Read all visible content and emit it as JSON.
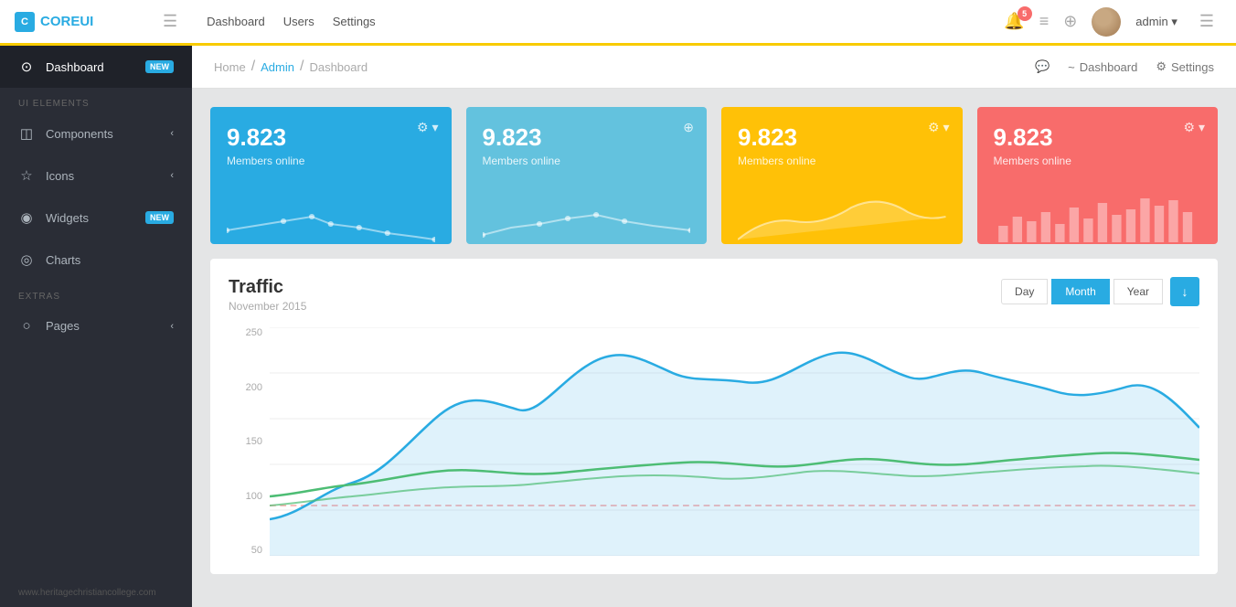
{
  "topNav": {
    "logo": "COREUI",
    "links": [
      "Dashboard",
      "Users",
      "Settings"
    ],
    "badge": "5",
    "adminLabel": "admin"
  },
  "sidebar": {
    "activeItem": "Dashboard",
    "items": [
      {
        "id": "dashboard",
        "label": "Dashboard",
        "icon": "⊙",
        "badge": "NEW",
        "active": true
      },
      {
        "id": "section-ui",
        "label": "UI ELEMENTS",
        "section": true
      },
      {
        "id": "components",
        "label": "Components",
        "icon": "◫",
        "chevron": "‹"
      },
      {
        "id": "icons",
        "label": "Icons",
        "icon": "☆",
        "chevron": "‹"
      },
      {
        "id": "widgets",
        "label": "Widgets",
        "icon": "◉",
        "badge": "NEW"
      },
      {
        "id": "charts",
        "label": "Charts",
        "icon": "◎"
      },
      {
        "id": "section-extras",
        "label": "EXTRAS",
        "section": true
      },
      {
        "id": "pages",
        "label": "Pages",
        "icon": "○",
        "chevron": "‹"
      }
    ],
    "footer": "www.heritagechristiancollege.com"
  },
  "breadcrumb": {
    "items": [
      "Home",
      "Admin",
      "Dashboard"
    ],
    "rightActions": [
      "Dashboard",
      "Settings"
    ]
  },
  "statCards": [
    {
      "id": "card1",
      "number": "9.823",
      "label": "Members online",
      "color": "blue1",
      "gearVisible": true
    },
    {
      "id": "card2",
      "number": "9.823",
      "label": "Members online",
      "color": "blue2",
      "gearVisible": false
    },
    {
      "id": "card3",
      "number": "9.823",
      "label": "Members online",
      "color": "yellow",
      "gearVisible": true
    },
    {
      "id": "card4",
      "number": "9.823",
      "label": "Members online",
      "color": "red",
      "gearVisible": true
    }
  ],
  "traffic": {
    "title": "Traffic",
    "subtitle": "November 2015",
    "periodButtons": [
      "Day",
      "Month",
      "Year"
    ],
    "activePeriod": "Month",
    "downloadIcon": "↓",
    "yLabels": [
      "250",
      "200",
      "150",
      "100",
      "50"
    ],
    "colors": {
      "cyan": "#29abe2",
      "green": "#4dbd74",
      "red": "#f86c6b"
    }
  }
}
